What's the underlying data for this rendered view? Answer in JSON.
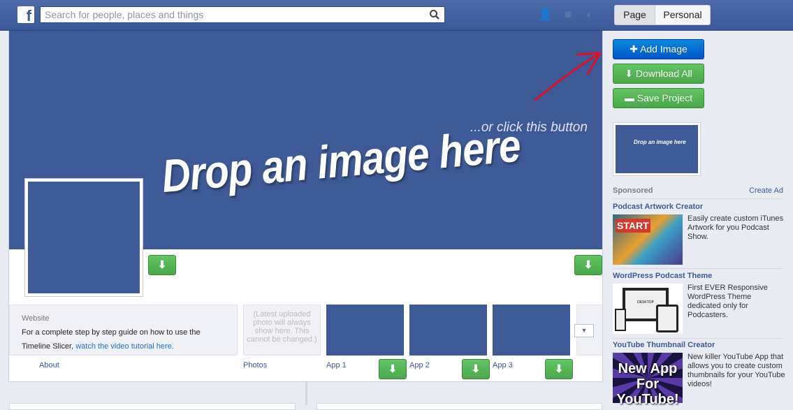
{
  "header": {
    "logo": "f",
    "search_placeholder": "Search for people, places and things",
    "icons": [
      "search-icon",
      "friends-icon",
      "messages-icon",
      "notifications-globe-icon"
    ],
    "toggle": [
      "Page",
      "Personal"
    ]
  },
  "cover": {
    "drop_text": "Drop an image here",
    "click_text": "...or click this button"
  },
  "info": {
    "label": "Website",
    "text": "For a complete step by step guide on how to use the Timeline Slicer, ",
    "link": "watch the video tutorial here."
  },
  "photos_placeholder": "(Latest uploaded photo will always show here. This cannot be changed.)",
  "tabs": {
    "about": "About",
    "photos": "Photos",
    "app1": "App 1",
    "app2": "App 2",
    "app3": "App 3"
  },
  "download_glyph": "⬇",
  "actions": {
    "add": "Add Image",
    "download": "Download All",
    "save": "Save Project"
  },
  "thumb_text": "Drop an image here",
  "sponsored": {
    "label": "Sponsored",
    "create": "Create Ad",
    "ads": [
      {
        "title": "Podcast Artwork Creator",
        "desc": "Easily create custom iTunes Artwork for you Podcast Show.",
        "img_text": "START"
      },
      {
        "title": "WordPress Podcast Theme",
        "desc": "First EVER Responsive WordPress Theme dedicated only for Podcasters.",
        "img_text": "DESKTOP"
      },
      {
        "title": "YouTube Thumbnail Creator",
        "desc": "New killer YouTube App that allows you to create custom thumbnails for your YouTube videos!",
        "img_text": "New App For YouTube!"
      }
    ]
  },
  "colors": {
    "facebook_blue": "#3b5998",
    "cover": "#3d5a96",
    "green": "#4aa84a",
    "primary": "#0a6fd6"
  }
}
